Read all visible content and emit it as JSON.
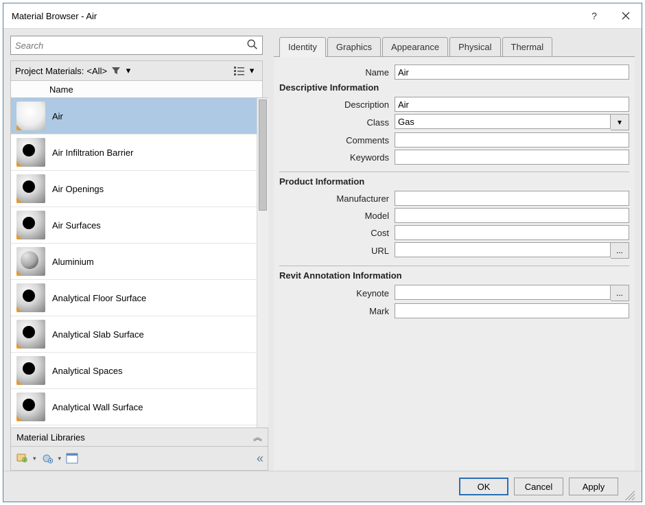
{
  "window": {
    "title": "Material Browser - Air"
  },
  "search": {
    "placeholder": "Search"
  },
  "project_header": {
    "label": "Project Materials:",
    "scope": "<All>"
  },
  "list": {
    "column": "Name",
    "items": [
      {
        "label": "Air",
        "selected": true,
        "style": "light"
      },
      {
        "label": "Air Infiltration Barrier",
        "style": "hole"
      },
      {
        "label": "Air Openings",
        "style": "hole"
      },
      {
        "label": "Air Surfaces",
        "style": "hole"
      },
      {
        "label": "Aluminium",
        "style": "sphere"
      },
      {
        "label": "Analytical Floor Surface",
        "style": "hole"
      },
      {
        "label": "Analytical Slab Surface",
        "style": "hole"
      },
      {
        "label": "Analytical Spaces",
        "style": "hole"
      },
      {
        "label": "Analytical Wall Surface",
        "style": "hole"
      }
    ]
  },
  "libraries": {
    "label": "Material Libraries"
  },
  "tabs": {
    "identity": "Identity",
    "graphics": "Graphics",
    "appearance": "Appearance",
    "physical": "Physical",
    "thermal": "Thermal"
  },
  "form": {
    "name": {
      "label": "Name",
      "value": "Air"
    },
    "sections": {
      "descriptive": "Descriptive Information",
      "product": "Product Information",
      "revit": "Revit Annotation Information"
    },
    "descriptive": {
      "description": {
        "label": "Description",
        "value": "Air"
      },
      "class": {
        "label": "Class",
        "value": "Gas"
      },
      "comments": {
        "label": "Comments",
        "value": ""
      },
      "keywords": {
        "label": "Keywords",
        "value": ""
      }
    },
    "product": {
      "manufacturer": {
        "label": "Manufacturer",
        "value": ""
      },
      "model": {
        "label": "Model",
        "value": ""
      },
      "cost": {
        "label": "Cost",
        "value": ""
      },
      "url": {
        "label": "URL",
        "value": ""
      }
    },
    "revit": {
      "keynote": {
        "label": "Keynote",
        "value": ""
      },
      "mark": {
        "label": "Mark",
        "value": ""
      }
    }
  },
  "footer": {
    "ok": "OK",
    "cancel": "Cancel",
    "apply": "Apply"
  }
}
